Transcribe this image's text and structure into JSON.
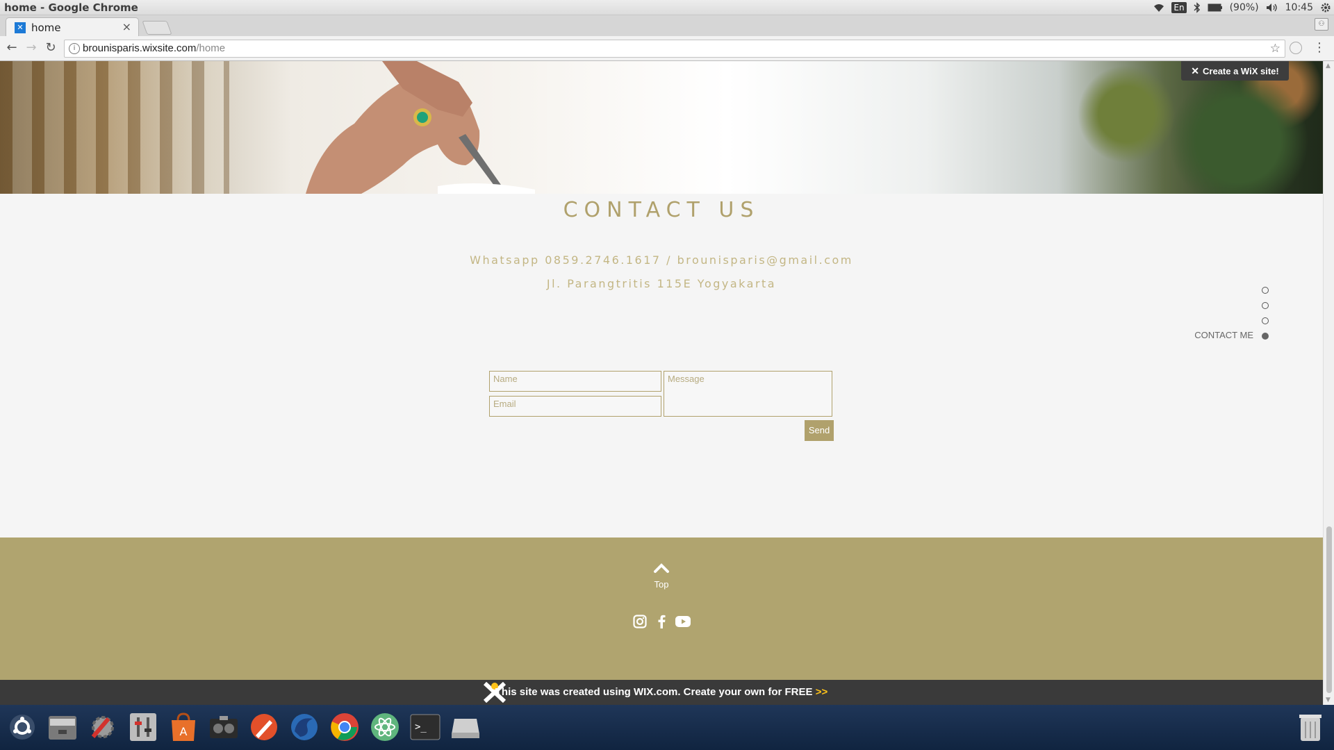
{
  "os": {
    "window_title": "home - Google Chrome",
    "lang": "En",
    "battery": "(90%)",
    "clock": "10:45"
  },
  "browser": {
    "tab_title": "home",
    "url_host": "brounisparis.wixsite.com",
    "url_path": "/home"
  },
  "page": {
    "wix_badge": "Create a WiX site!",
    "contact_heading": "CONTACT US",
    "contact_line1": "Whatsapp 0859.2746.1617 / brounisparis@gmail.com",
    "contact_line2": "Jl. Parangtritis 115E Yogyakarta",
    "form": {
      "name_placeholder": "Name",
      "email_placeholder": "Email",
      "message_placeholder": "Message",
      "send_label": "Send"
    },
    "side_nav": {
      "active_label": "CONTACT ME",
      "dots": 4,
      "active_index": 4
    },
    "footer": {
      "top_label": "Top",
      "social": [
        "instagram-icon",
        "facebook-icon",
        "youtube-icon"
      ]
    },
    "wix_banner": {
      "text": "This site was created using WIX.com. Create your own for FREE",
      "arrows": ">>"
    }
  },
  "dock": {
    "items": [
      "ubuntu-icon",
      "files-icon",
      "settings-icon",
      "mixer-icon",
      "software-center-icon",
      "radio-icon",
      "inkscape-icon",
      "firefox-icon",
      "chrome-icon",
      "atom-icon",
      "terminal-icon",
      "drive-icon",
      "trash-icon"
    ]
  },
  "colors": {
    "accent": "#b0a16c",
    "footer": "#b0a46f",
    "banner": "#3a3a3a",
    "banner_arrows": "#ffc31a"
  }
}
